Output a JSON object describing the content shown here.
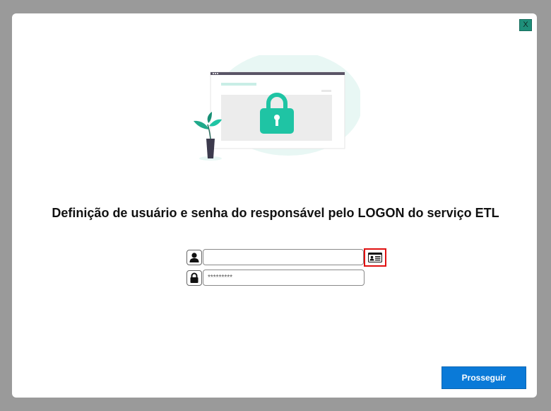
{
  "dialog": {
    "close_label": "X",
    "title": "Definição de usuário e senha do responsável pelo LOGON do serviço ETL"
  },
  "form": {
    "user_value": "",
    "password_value": "*********"
  },
  "actions": {
    "proceed_label": "Prosseguir"
  },
  "colors": {
    "accent": "#1fc4a4",
    "button": "#0a7ad8",
    "highlight_border": "#e01010"
  },
  "icons": {
    "user": "user-icon",
    "lock": "lock-icon",
    "card": "id-card-icon"
  }
}
